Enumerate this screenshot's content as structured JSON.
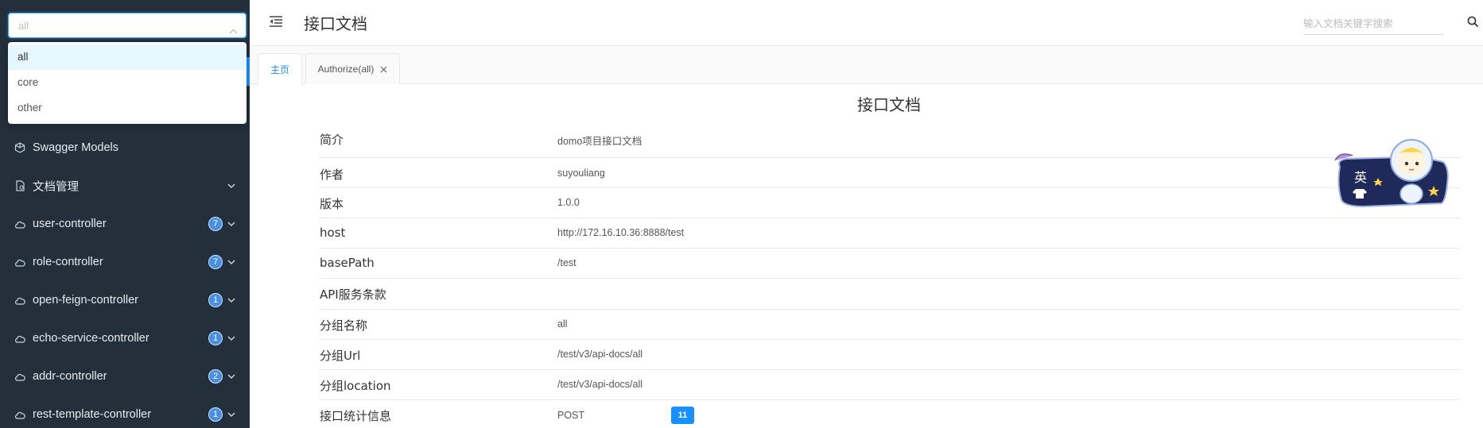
{
  "group_select": {
    "value": "all",
    "options": [
      "all",
      "core",
      "other"
    ]
  },
  "sidebar": {
    "items": [
      {
        "label": "Swagger Models",
        "icon": "cube-icon"
      },
      {
        "label": "文档管理",
        "icon": "document-icon"
      },
      {
        "label": "user-controller",
        "icon": "cloud-icon",
        "count": "7"
      },
      {
        "label": "role-controller",
        "icon": "cloud-icon",
        "count": "7"
      },
      {
        "label": "open-feign-controller",
        "icon": "cloud-icon",
        "count": "1"
      },
      {
        "label": "echo-service-controller",
        "icon": "cloud-icon",
        "count": "1"
      },
      {
        "label": "addr-controller",
        "icon": "cloud-icon",
        "count": "2"
      },
      {
        "label": "rest-template-controller",
        "icon": "cloud-icon",
        "count": "1"
      }
    ]
  },
  "header": {
    "title": "接口文档",
    "search_placeholder": "输入文档关键字搜索"
  },
  "tabs": [
    {
      "label": "主页"
    },
    {
      "label": "Authorize(all)"
    }
  ],
  "doc": {
    "title": "接口文档",
    "rows": [
      {
        "key": "简介",
        "value": "domo项目接口文档"
      },
      {
        "key": "作者",
        "value": "suyouliang"
      },
      {
        "key": "版本",
        "value": "1.0.0"
      },
      {
        "key": "host",
        "value": "http://172.16.10.36:8888/test"
      },
      {
        "key": "basePath",
        "value": "/test"
      },
      {
        "key": "API服务条款",
        "value": ""
      },
      {
        "key": "分组名称",
        "value": "all"
      },
      {
        "key": "分组Url",
        "value": "/test/v3/api-docs/all"
      },
      {
        "key": "分组location",
        "value": "/test/v3/api-docs/all"
      },
      {
        "key": "接口统计信息",
        "value": "POST",
        "badge": "11"
      }
    ]
  },
  "mascot": {
    "label": "英"
  },
  "colors": {
    "sidebar_bg": "#232f3b",
    "accent": "#1890ff",
    "badge": "#4a90e2"
  }
}
